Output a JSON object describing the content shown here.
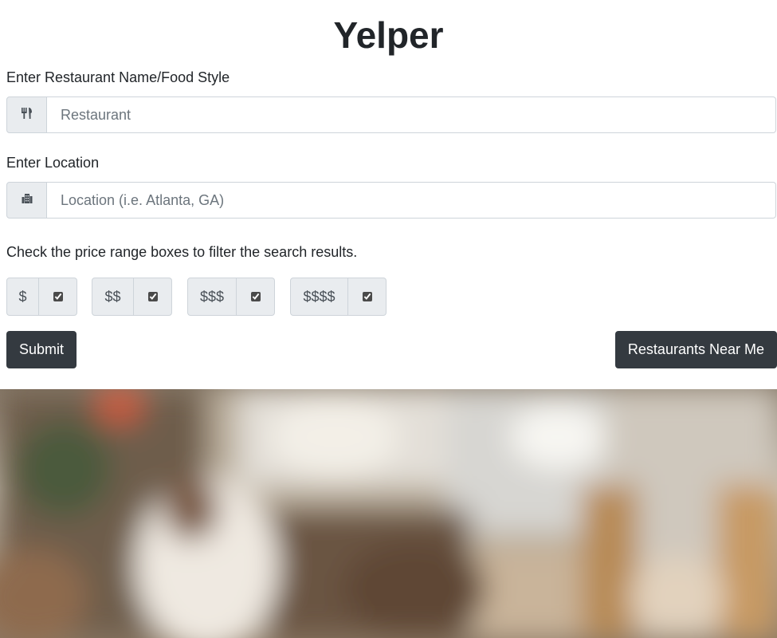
{
  "app": {
    "title": "Yelper"
  },
  "restaurant": {
    "label": "Enter Restaurant Name/Food Style",
    "placeholder": "Restaurant",
    "value": "",
    "icon": "utensils-icon"
  },
  "location": {
    "label": "Enter Location",
    "placeholder": "Location (i.e. Atlanta, GA)",
    "value": "",
    "icon": "city-icon"
  },
  "price": {
    "helper": "Check the price range boxes to filter the search results.",
    "options": [
      {
        "label": "$",
        "checked": true
      },
      {
        "label": "$$",
        "checked": true
      },
      {
        "label": "$$$",
        "checked": true
      },
      {
        "label": "$$$$",
        "checked": true
      }
    ]
  },
  "actions": {
    "submit_label": "Submit",
    "near_me_label": "Restaurants Near Me"
  },
  "colors": {
    "button_bg": "#343a40",
    "addon_bg": "#e9ecef",
    "border": "#ced4da"
  }
}
